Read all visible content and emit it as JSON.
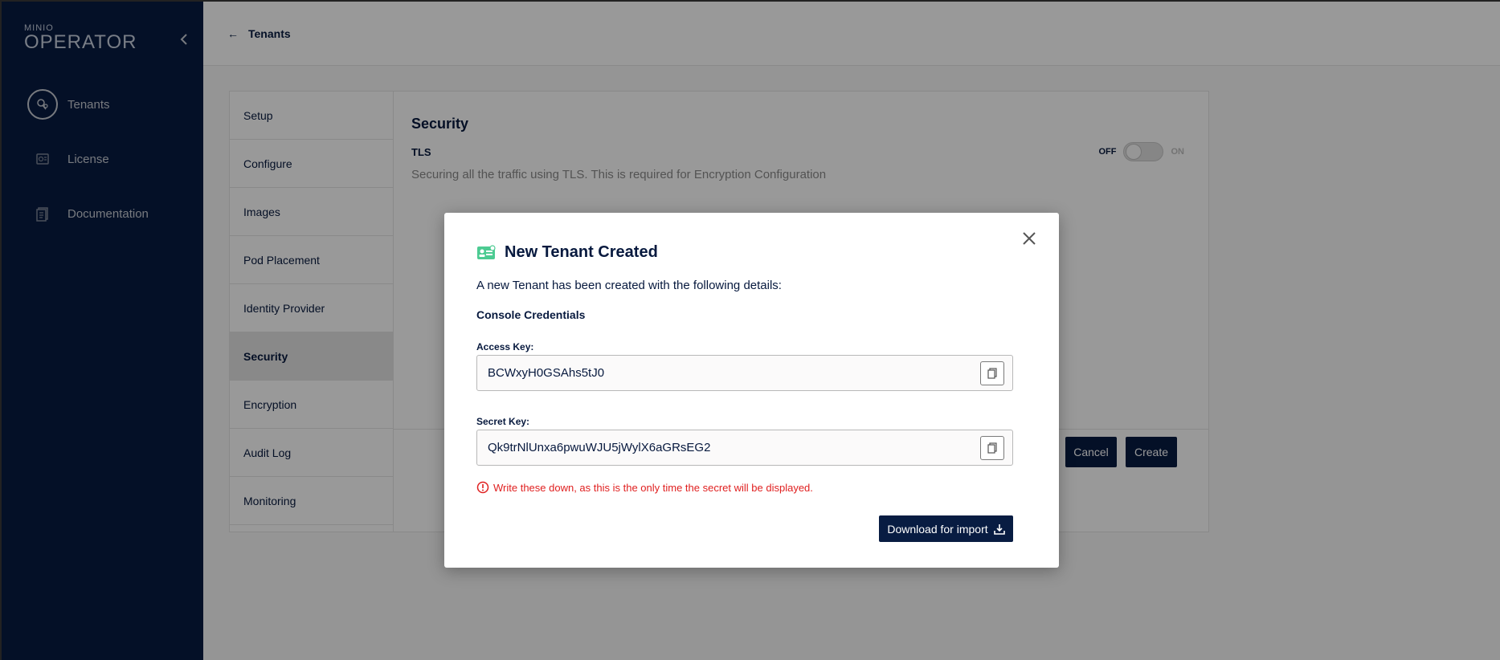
{
  "sidebar": {
    "logo_small": "MINIO",
    "logo_big": "OPERATOR",
    "items": [
      {
        "label": "Tenants"
      },
      {
        "label": "License"
      },
      {
        "label": "Documentation"
      }
    ]
  },
  "topbar": {
    "back_label": "Tenants"
  },
  "wizard": {
    "steps": [
      "Setup",
      "Configure",
      "Images",
      "Pod Placement",
      "Identity Provider",
      "Security",
      "Encryption",
      "Audit Log",
      "Monitoring"
    ],
    "active_step": "Security",
    "panel_title": "Security",
    "tls_label": "TLS",
    "tls_description": "Securing all the traffic using TLS. This is required for Encryption Configuration",
    "toggle_off": "OFF",
    "toggle_on": "ON",
    "cancel_label": "Cancel",
    "create_label": "Create"
  },
  "modal": {
    "title": "New Tenant Created",
    "intro": "A new Tenant has been created with the following details:",
    "credentials_title": "Console Credentials",
    "access_key_label": "Access Key:",
    "access_key_value": "BCWxyH0GSAhs5tJ0",
    "secret_key_label": "Secret Key:",
    "secret_key_value": "Qk9trNlUnxa6pwuWJU5jWylX6aGRsEG2",
    "warning": "Write these down, as this is the only time the secret will be displayed.",
    "download_label": "Download for import"
  },
  "colors": {
    "sidebar_bg": "#081c42",
    "accent_green": "#4ccb92",
    "warning_red": "#e02020"
  }
}
